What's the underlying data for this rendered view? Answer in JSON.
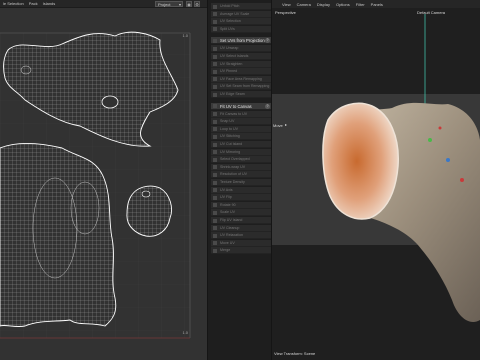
{
  "uv_menu": {
    "items": [
      "le Selection",
      "Pack",
      "Islands"
    ],
    "project_dropdown": "Project",
    "icon_a": "eye-icon",
    "icon_b": "settings-icon"
  },
  "uv_axis": {
    "v_top": "1.0",
    "u_right": "1.0"
  },
  "panel": {
    "items": [
      {
        "label": "Unfold Pitch",
        "active": false
      },
      {
        "label": "Average UV Scale",
        "active": false
      },
      {
        "label": "UV Selection",
        "active": false
      },
      {
        "label": "Split UVs",
        "active": false
      },
      {
        "label": "Set UVs from Projection",
        "active": true
      },
      {
        "label": "UV Unwrap",
        "active": false
      },
      {
        "label": "UV Select Islands",
        "active": false
      },
      {
        "label": "UV Straighten",
        "active": false
      },
      {
        "label": "UV Pinned",
        "active": false
      },
      {
        "label": "UV Face Area Remapping",
        "active": false
      },
      {
        "label": "UV Set Seam from Remapping",
        "active": false
      },
      {
        "label": "UV Edge Seam",
        "active": false
      },
      {
        "label": "Fit UV to Canvas",
        "active": true
      },
      {
        "label": "Fit Canvas to UV",
        "active": false
      },
      {
        "label": "Snap UV",
        "active": false
      },
      {
        "label": "Loop to UV",
        "active": false
      },
      {
        "label": "UV Stitching",
        "active": false
      },
      {
        "label": "UV Cut Island",
        "active": false
      },
      {
        "label": "UV Mirroring",
        "active": false
      },
      {
        "label": "Select Overlapped",
        "active": false
      },
      {
        "label": "Shrink-wrap UV",
        "active": false
      },
      {
        "label": "Resolution of UV",
        "active": false
      },
      {
        "label": "Texture Density",
        "active": false
      },
      {
        "label": "UV Axis",
        "active": false
      },
      {
        "label": "UV Flip",
        "active": false
      },
      {
        "label": "Rotate 90",
        "active": false
      },
      {
        "label": "Scale UV",
        "active": false
      },
      {
        "label": "Flip UV Island",
        "active": false
      },
      {
        "label": "UV Cleanup",
        "active": false
      },
      {
        "label": "UV Relaxation",
        "active": false
      },
      {
        "label": "Move UV",
        "active": false
      },
      {
        "label": "Merge",
        "active": false
      }
    ]
  },
  "viewport": {
    "menu": [
      "View",
      "Camera",
      "Display",
      "Options",
      "Filter",
      "Panels"
    ],
    "perspective_label": "Perspective",
    "camera_label": "Default Camera",
    "move_label": "Move",
    "status": "View Transform: Scene",
    "colors": {
      "bg_dark": "#1f1f1f",
      "bg_mid": "#383838",
      "shell_outer": "#b9ad9a",
      "shell_inner": "#d98c53"
    }
  }
}
